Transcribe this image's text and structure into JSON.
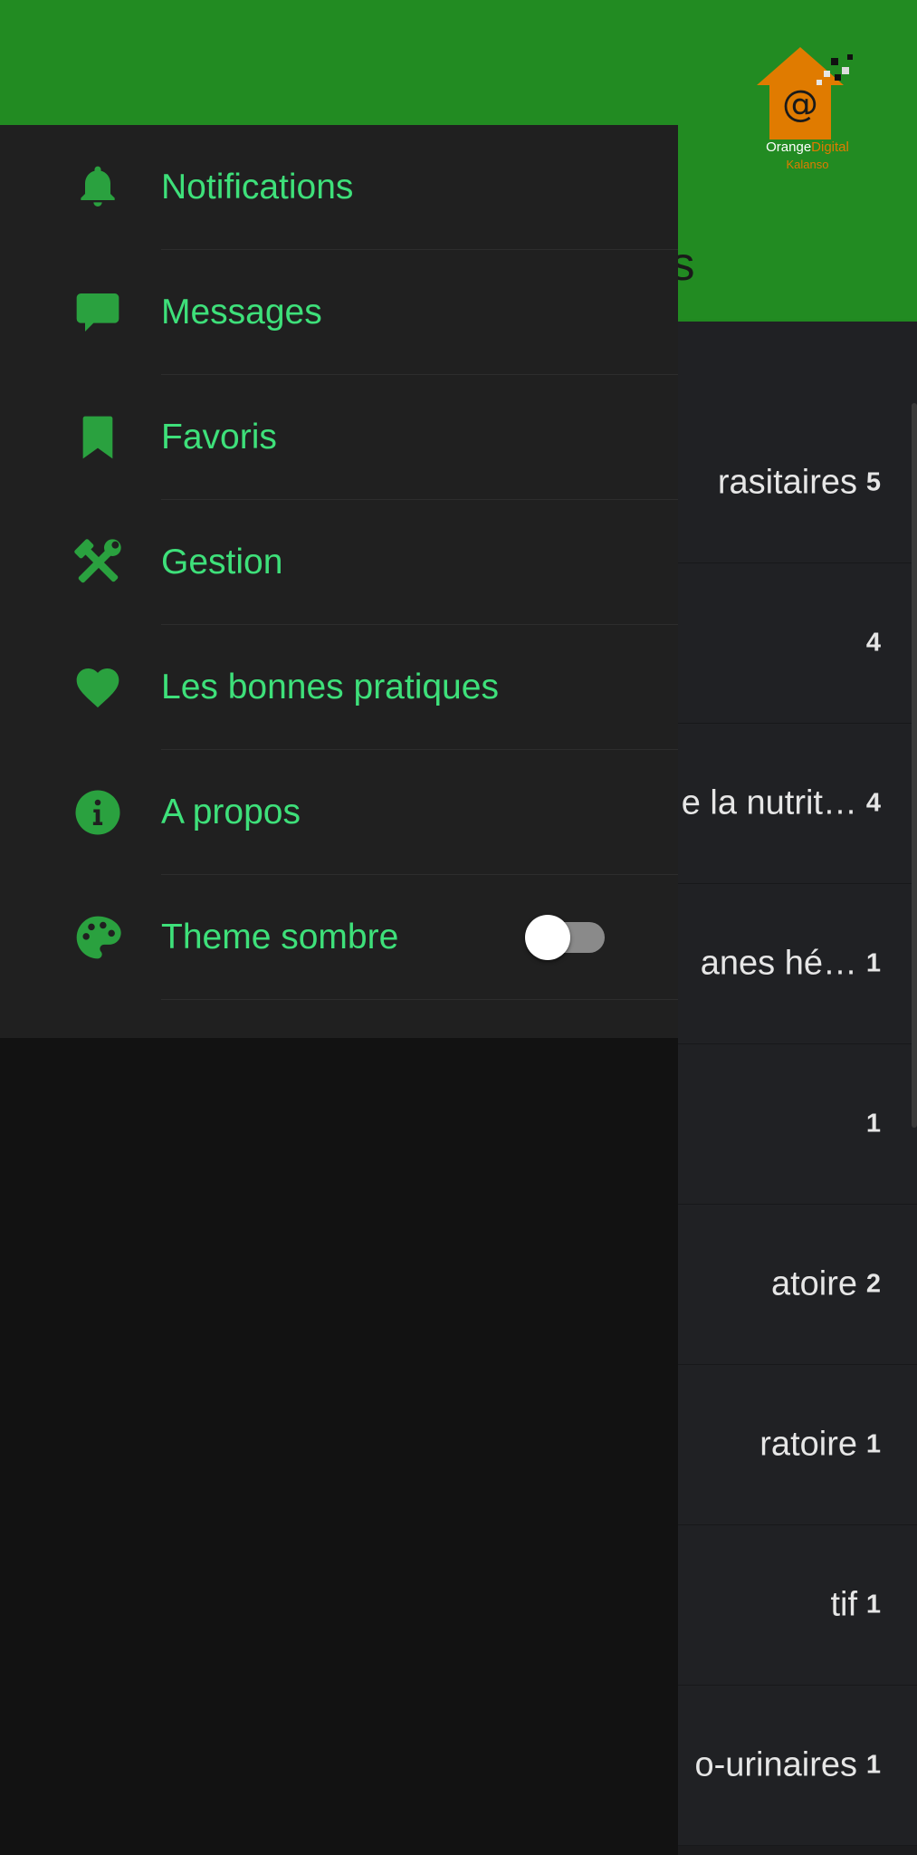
{
  "background": {
    "title_fragment": "ls",
    "logo": {
      "text_orange": "Orange",
      "text_digital": "Digital",
      "text_kalanso": "Kalanso",
      "at_symbol": "@"
    },
    "rows": [
      {
        "title": "rasitaires",
        "count": "5"
      },
      {
        "title": "",
        "count": "4"
      },
      {
        "title": "e la nutrit…",
        "count": "4"
      },
      {
        "title": "anes hé…",
        "count": "1"
      },
      {
        "title": "",
        "count": "1"
      },
      {
        "title": "atoire",
        "count": "2"
      },
      {
        "title": "ratoire",
        "count": "1"
      },
      {
        "title": "tif",
        "count": "1"
      },
      {
        "title": "o-urinaires",
        "count": "1"
      }
    ]
  },
  "drawer": {
    "menu": [
      {
        "label": "Notifications",
        "icon": "bell-icon"
      },
      {
        "label": "Messages",
        "icon": "chat-icon"
      },
      {
        "label": "Favoris",
        "icon": "bookmark-icon"
      },
      {
        "label": "Gestion",
        "icon": "tools-icon"
      },
      {
        "label": "Les bonnes pratiques",
        "icon": "heart-icon"
      },
      {
        "label": "A propos",
        "icon": "info-icon"
      },
      {
        "label": "Theme sombre",
        "icon": "palette-icon"
      }
    ],
    "dark_theme_enabled": false
  },
  "colors": {
    "accent_green": "#228b22",
    "label_green": "#3ee07a",
    "logo_orange": "#e07b00"
  }
}
